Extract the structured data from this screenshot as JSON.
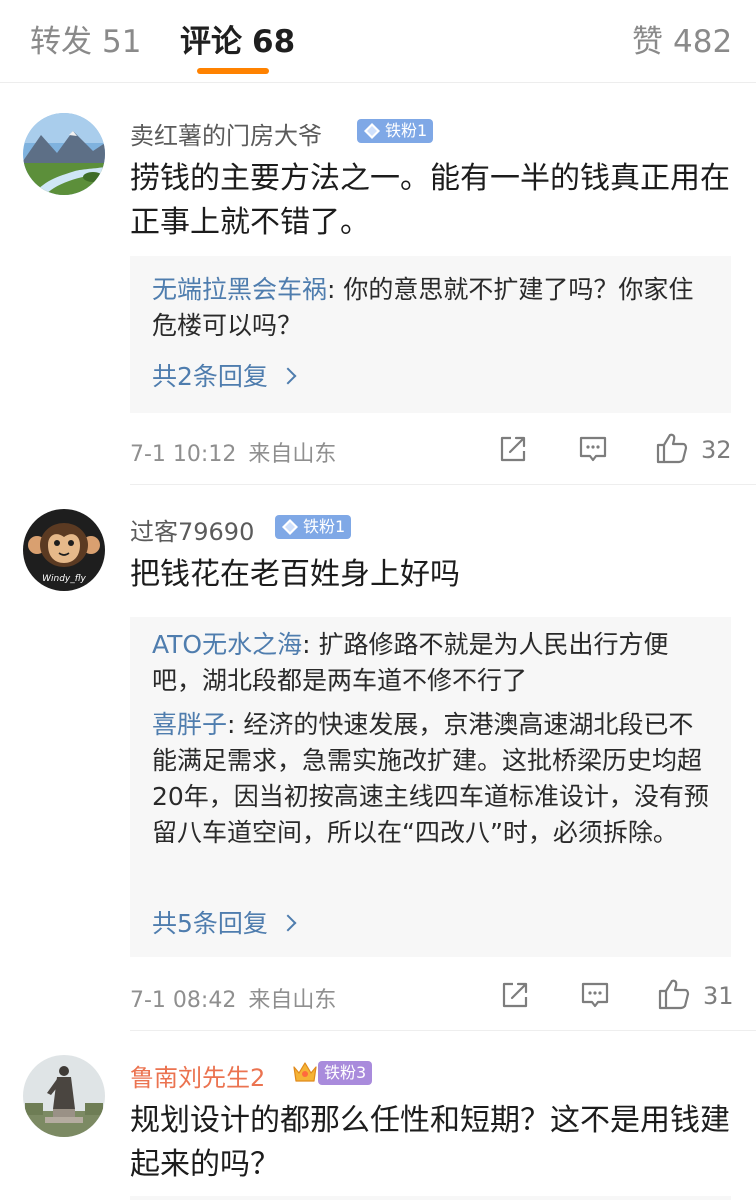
{
  "tabs": {
    "repost": {
      "label": "转发",
      "count": "51"
    },
    "comment": {
      "label": "评论",
      "count": "68"
    },
    "like": {
      "label": "赞",
      "count": "482"
    }
  },
  "comments": [
    {
      "user": "卖红薯的门房大爷",
      "badge": "铁粉1",
      "content": "捞钱的主要方法之一。能有一半的钱真正用在正事上就不错了。",
      "replies": [
        {
          "name": "无端拉黑会车祸",
          "sep": ": ",
          "text": "你的意思就不扩建了吗？你家住危楼可以吗？"
        }
      ],
      "more": "共2条回复",
      "time": "7-1 10:12",
      "source": "来自山东",
      "likes": "32"
    },
    {
      "user": "过客79690",
      "badge": "铁粉1",
      "avatar_caption": "Windy_fly",
      "content": "把钱花在老百姓身上好吗",
      "replies": [
        {
          "name": "ATO无水之海",
          "sep": ": ",
          "text": "扩路修路不就是为人民出行方便吧，湖北段都是两车道不修不行了"
        },
        {
          "name": "喜胖子",
          "sep": ": ",
          "text": "经济的快速发展，京港澳高速湖北段已不能满足需求，急需实施改扩建。这批桥梁历史均超20年，因当初按高速主线四车道标准设计，没有预留八车道空间，所以在“四改八”时，必须拆除。"
        }
      ],
      "more": "共5条回复",
      "time": "7-1 08:42",
      "source": "来自山东",
      "likes": "31"
    },
    {
      "user": "鲁南刘先生2",
      "badge": "铁粉3",
      "content": "规划设计的都那么任性和短期？这不是用钱建起来的吗？"
    }
  ],
  "colors": {
    "accent": "#ff8200",
    "link": "#4f7dae",
    "badge_blue": "#7fa8e6",
    "badge_purple": "#a98bdc",
    "gold_name": "#eb7350"
  },
  "icons": [
    "repost-icon",
    "comment-icon",
    "thumbs-up-icon",
    "chevron-right-icon",
    "diamond-icon",
    "crown-icon"
  ]
}
